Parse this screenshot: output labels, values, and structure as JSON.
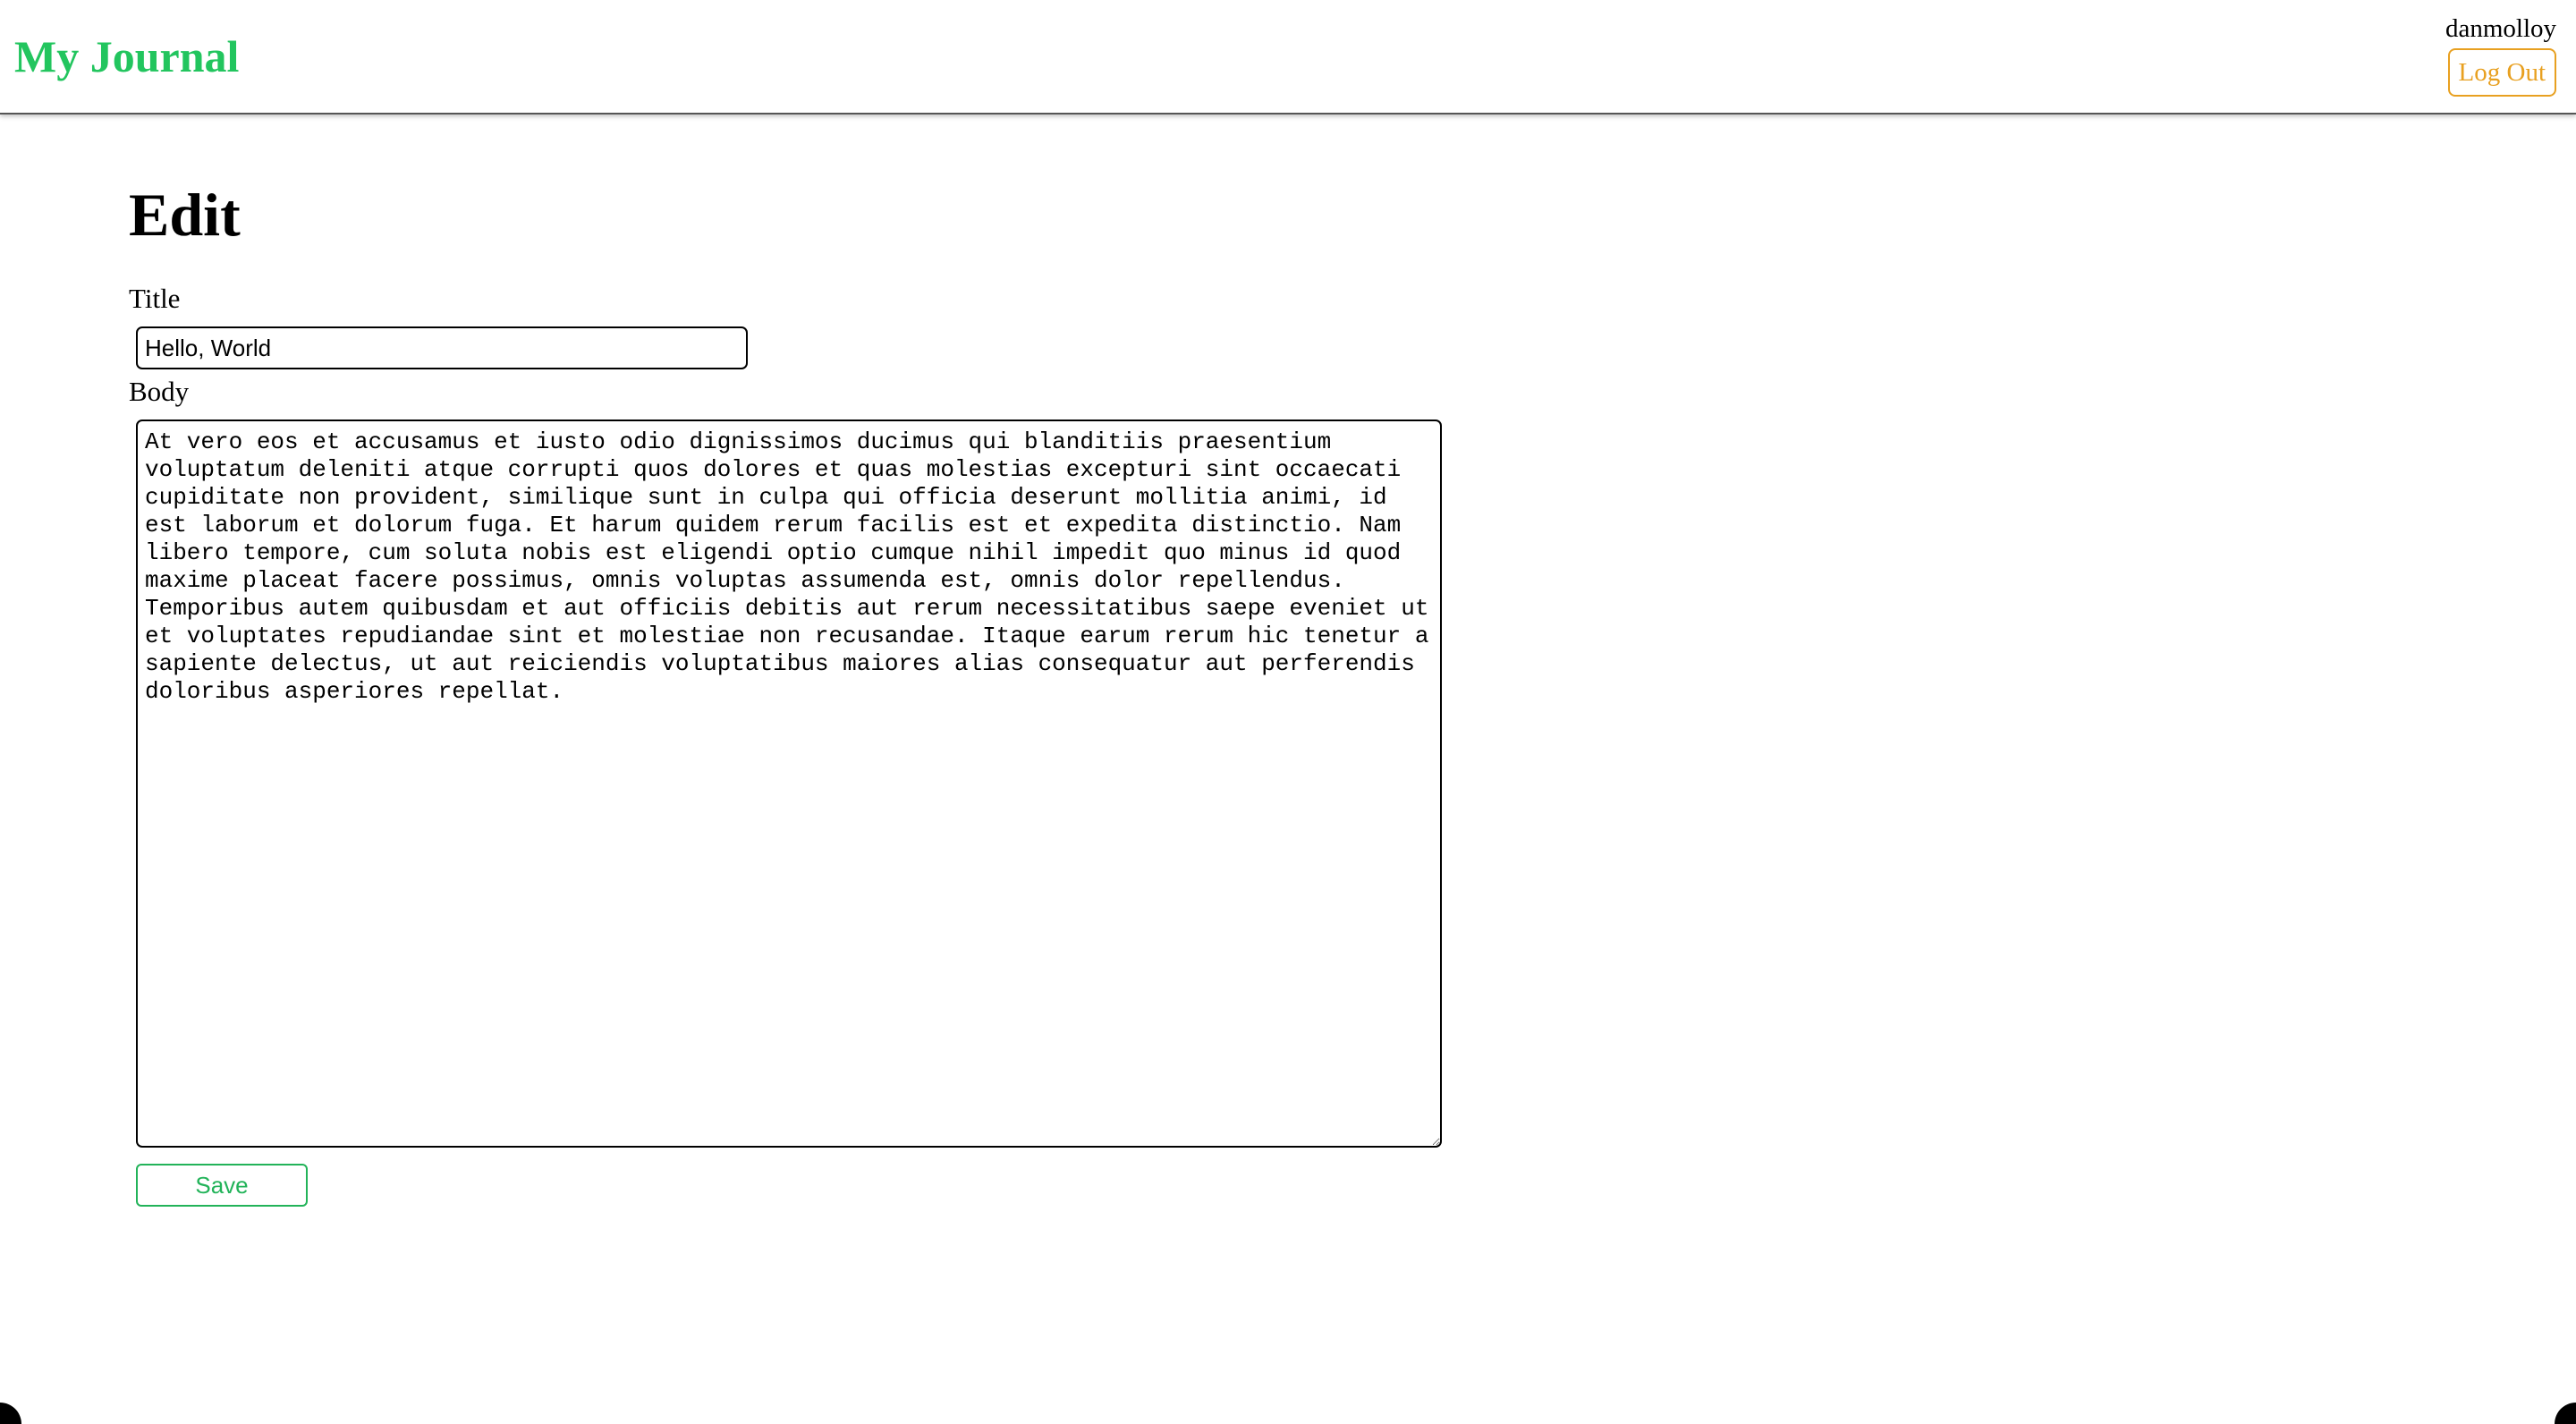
{
  "colors": {
    "brand": "#22c55e",
    "logout": "#e8a020",
    "save": "#22b359"
  },
  "header": {
    "brand": "My Journal",
    "username": "danmolloy",
    "logout_label": "Log Out"
  },
  "main": {
    "page_title": "Edit",
    "title_label": "Title",
    "title_value": "Hello, World",
    "body_label": "Body",
    "body_value": "At vero eos et accusamus et iusto odio dignissimos ducimus qui blanditiis praesentium voluptatum deleniti atque corrupti quos dolores et quas molestias excepturi sint occaecati cupiditate non provident, similique sunt in culpa qui officia deserunt mollitia animi, id est laborum et dolorum fuga. Et harum quidem rerum facilis est et expedita distinctio. Nam libero tempore, cum soluta nobis est eligendi optio cumque nihil impedit quo minus id quod maxime placeat facere possimus, omnis voluptas assumenda est, omnis dolor repellendus. Temporibus autem quibusdam et aut officiis debitis aut rerum necessitatibus saepe eveniet ut et voluptates repudiandae sint et molestiae non recusandae. Itaque earum rerum hic tenetur a sapiente delectus, ut aut reiciendis voluptatibus maiores alias consequatur aut perferendis doloribus asperiores repellat.",
    "save_label": "Save"
  }
}
